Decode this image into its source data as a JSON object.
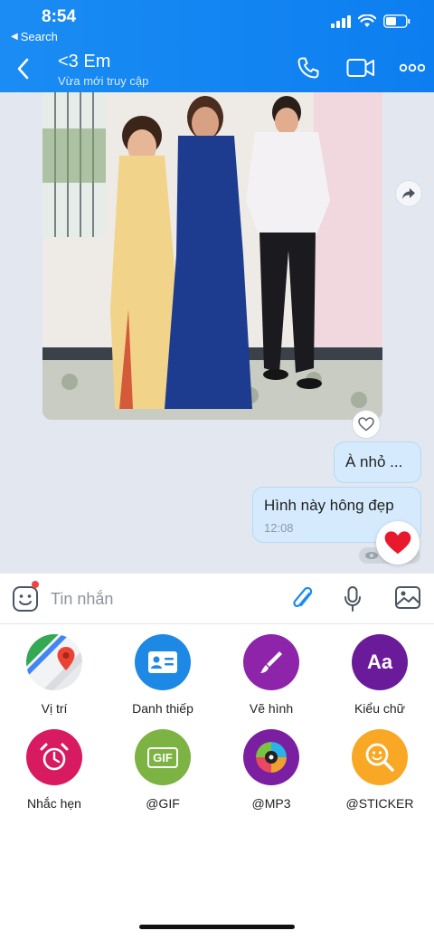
{
  "status_bar": {
    "time": "8:54",
    "back_label": "Search"
  },
  "header": {
    "title": "<3 Em",
    "subtitle": "Vừa mới truy cập",
    "icons": [
      "back-arrow-icon",
      "phone-icon",
      "video-camera-icon",
      "more-dots-icon"
    ]
  },
  "messages": [
    {
      "type": "image",
      "description_icon": "photo"
    },
    {
      "type": "text",
      "text": "À nhỏ ..."
    },
    {
      "type": "text",
      "text": "Hình này hông đẹp",
      "time": "12:08",
      "reaction": "heart"
    }
  ],
  "composer": {
    "placeholder": "Tin nhắn",
    "icons": [
      "emoji-icon",
      "paperclip-icon",
      "microphone-icon",
      "image-icon"
    ]
  },
  "tools": [
    {
      "label": "Vị trí",
      "icon": "map-pin-icon",
      "color": "#4caf50"
    },
    {
      "label": "Danh thiếp",
      "icon": "contact-card-icon",
      "color": "#1e88e5"
    },
    {
      "label": "Vẽ hình",
      "icon": "brush-icon",
      "color": "#8e24aa"
    },
    {
      "label": "Kiểu chữ",
      "icon": "font-icon",
      "color": "#6a1b9a",
      "glyph": "Aa"
    },
    {
      "label": "Nhắc hẹn",
      "icon": "alarm-clock-icon",
      "color": "#d81b60"
    },
    {
      "label": "@GIF",
      "icon": "gif-icon",
      "color": "#7cb342",
      "glyph": "GIF"
    },
    {
      "label": "@MP3",
      "icon": "music-disc-icon",
      "color": "#7b1fa2"
    },
    {
      "label": "@STICKER",
      "icon": "sticker-search-icon",
      "color": "#f9a825"
    }
  ],
  "colors": {
    "header": "#1a8cf3",
    "bubble": "#d5ebfd",
    "chat_bg": "#e3e8f0",
    "reaction": "#e8192c"
  }
}
